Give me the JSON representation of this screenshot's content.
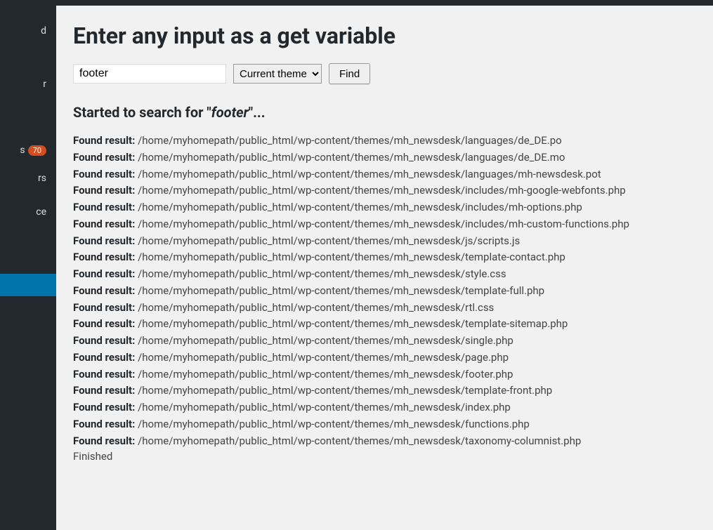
{
  "sidebar": {
    "items": [
      {
        "label": "d"
      },
      {
        "label": "r"
      },
      {
        "label": "s",
        "badge": "70"
      },
      {
        "label": "rs"
      },
      {
        "label": "ce"
      },
      {
        "label": ""
      }
    ]
  },
  "page": {
    "title": "Enter any input as a get variable"
  },
  "form": {
    "search_value": "footer",
    "select_value": "Current theme",
    "button_label": "Find"
  },
  "status": {
    "prefix": "Started to search for \"",
    "term": "footer",
    "suffix": "\"..."
  },
  "result_label": "Found result:",
  "results": [
    "/home/myhomepath/public_html/wp-content/themes/mh_newsdesk/languages/de_DE.po",
    "/home/myhomepath/public_html/wp-content/themes/mh_newsdesk/languages/de_DE.mo",
    "/home/myhomepath/public_html/wp-content/themes/mh_newsdesk/languages/mh-newsdesk.pot",
    "/home/myhomepath/public_html/wp-content/themes/mh_newsdesk/includes/mh-google-webfonts.php",
    "/home/myhomepath/public_html/wp-content/themes/mh_newsdesk/includes/mh-options.php",
    "/home/myhomepath/public_html/wp-content/themes/mh_newsdesk/includes/mh-custom-functions.php",
    "/home/myhomepath/public_html/wp-content/themes/mh_newsdesk/js/scripts.js",
    "/home/myhomepath/public_html/wp-content/themes/mh_newsdesk/template-contact.php",
    "/home/myhomepath/public_html/wp-content/themes/mh_newsdesk/style.css",
    "/home/myhomepath/public_html/wp-content/themes/mh_newsdesk/template-full.php",
    "/home/myhomepath/public_html/wp-content/themes/mh_newsdesk/rtl.css",
    "/home/myhomepath/public_html/wp-content/themes/mh_newsdesk/template-sitemap.php",
    "/home/myhomepath/public_html/wp-content/themes/mh_newsdesk/single.php",
    "/home/myhomepath/public_html/wp-content/themes/mh_newsdesk/page.php",
    "/home/myhomepath/public_html/wp-content/themes/mh_newsdesk/footer.php",
    "/home/myhomepath/public_html/wp-content/themes/mh_newsdesk/template-front.php",
    "/home/myhomepath/public_html/wp-content/themes/mh_newsdesk/index.php",
    "/home/myhomepath/public_html/wp-content/themes/mh_newsdesk/functions.php",
    "/home/myhomepath/public_html/wp-content/themes/mh_newsdesk/taxonomy-columnist.php"
  ],
  "finished_label": "Finished"
}
